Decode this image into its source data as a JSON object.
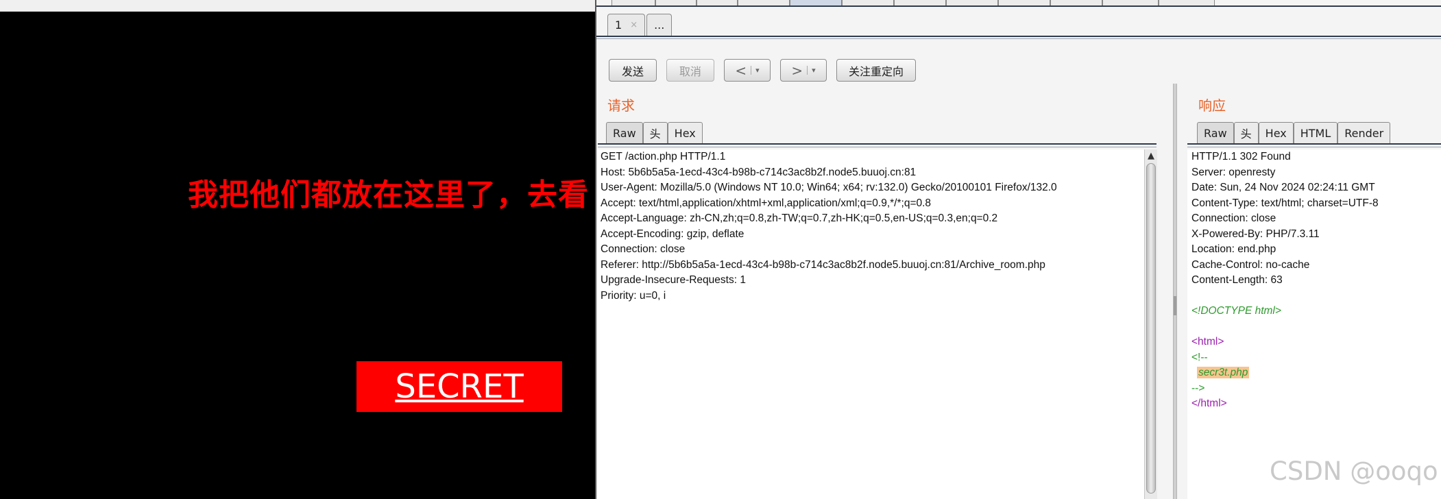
{
  "page": {
    "heading": "我把他们都放在这里了，去看",
    "secret_button": "SECRET"
  },
  "burp": {
    "top_tab_count": 12,
    "subtabs": [
      {
        "label": "1",
        "close": "×"
      },
      {
        "label": "..."
      }
    ],
    "toolbar": {
      "send": "发送",
      "cancel": "取消",
      "back": "<",
      "forward": ">",
      "dropdown": "▾",
      "follow_redirect": "关注重定向"
    },
    "request": {
      "title": "请求",
      "tabs": [
        "Raw",
        "头",
        "Hex"
      ],
      "lines": [
        "GET /action.php HTTP/1.1",
        "Host: 5b6b5a5a-1ecd-43c4-b98b-c714c3ac8b2f.node5.buuoj.cn:81",
        "User-Agent: Mozilla/5.0 (Windows NT 10.0; Win64; x64; rv:132.0) Gecko/20100101 Firefox/132.0",
        "Accept: text/html,application/xhtml+xml,application/xml;q=0.9,*/*;q=0.8",
        "Accept-Language: zh-CN,zh;q=0.8,zh-TW;q=0.7,zh-HK;q=0.5,en-US;q=0.3,en;q=0.2",
        "Accept-Encoding: gzip, deflate",
        "Connection: close",
        "Referer: http://5b6b5a5a-1ecd-43c4-b98b-c714c3ac8b2f.node5.buuoj.cn:81/Archive_room.php",
        "Upgrade-Insecure-Requests: 1",
        "Priority: u=0, i"
      ],
      "scroll_up": "▲"
    },
    "response": {
      "title": "响应",
      "tabs": [
        "Raw",
        "头",
        "Hex",
        "HTML",
        "Render"
      ],
      "header_lines": [
        "HTTP/1.1 302 Found",
        "Server: openresty",
        "Date: Sun, 24 Nov 2024 02:24:11 GMT",
        "Content-Type: text/html; charset=UTF-8",
        "Connection: close",
        "X-Powered-By: PHP/7.3.11",
        "Location: end.php",
        "Cache-Control: no-cache",
        "Content-Length: 63"
      ],
      "body": {
        "doctype": "<!DOCTYPE html>",
        "html_open": "<html>",
        "comment_open": "<!--",
        "comment_text": "secr3t.php",
        "comment_close": "-->",
        "html_close": "</html>"
      }
    }
  },
  "watermark": "CSDN @ooqo",
  "colors": {
    "heading": "#ff0000",
    "secret_button_bg": "#ff0000",
    "pane_title": "#e8632a",
    "tab_rule": "#2f3b4e",
    "doctype": "#2e9a2e",
    "tag": "#9b1fae",
    "highlight": "#f7c58f"
  }
}
